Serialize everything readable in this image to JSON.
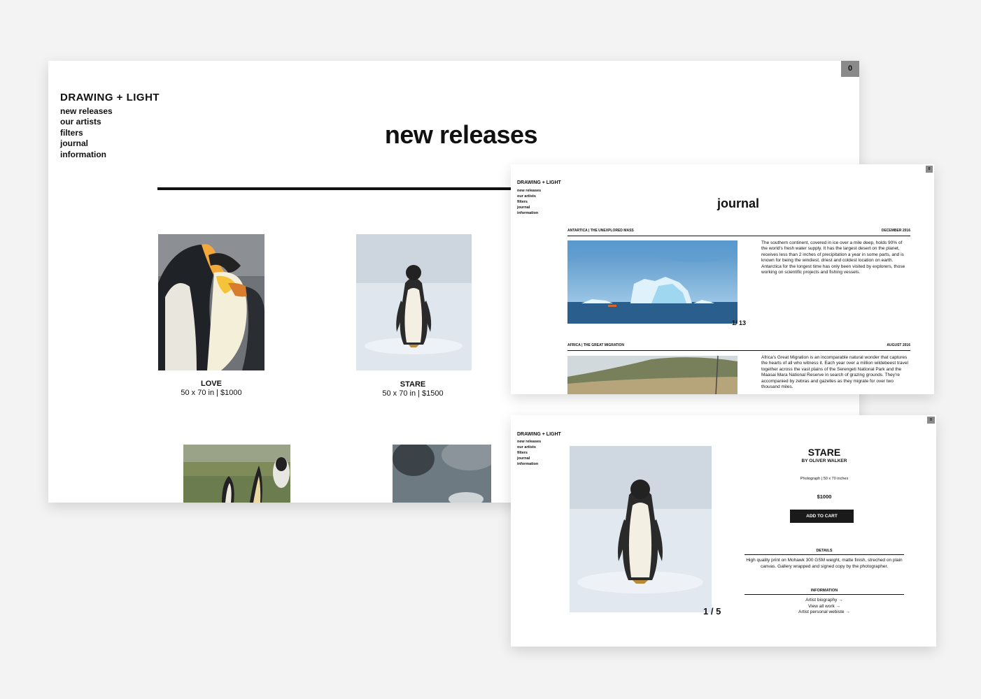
{
  "brand": "DRAWING + LIGHT",
  "nav": [
    "new releases",
    "our artists",
    "filters",
    "journal",
    "information"
  ],
  "cart_count": "0",
  "new_releases": {
    "title": "new releases",
    "items": [
      {
        "title": "LOVE",
        "meta": "50 x 70 in | $1000"
      },
      {
        "title": "STARE",
        "meta": "50 x 70 in | $1500"
      }
    ]
  },
  "journal": {
    "title": "journal",
    "entries": [
      {
        "heading": "ANTARTICA | THE UNEXPLORED MASS",
        "date": "DECEMBER 2016",
        "text": "The southern continent, covered in ice over a mile deep, holds 90% of the world's fresh water supply. It has the largest desert on the planet, receives less than 2 inches of precipitation a year in some parts, and is known for being the windiest, driest and coldest location on earth. Antarctica for the longest time has only been visited by explorers, those working on scientific projects and fishing vessels.",
        "counter": "1/ 13"
      },
      {
        "heading": "AFRICA | THE GREAT MIGRATION",
        "date": "AUGUST 2016",
        "text": "Africa's Great Migration is an incomparable natural wonder that captures the hearts of all who witness it. Each year over a million wildebeest travel together across the vast plains of the Serengeti National Park and the Maasai Mara National Reserve in search of grazing grounds. They're accompanied by zebras and gazelles as they migrate for over two thousand miles."
      }
    ]
  },
  "product": {
    "title": "STARE",
    "by": "BY OLIVER WALKER",
    "meta": "Photograph  |  50 x 70 inches",
    "price": "$1000",
    "add_to_cart": "ADD TO CART",
    "details_label": "DETAILS",
    "details_text": "High quality print on Mohawk 300 GSM weight, matte finish, streched on plain canvas. Gallery wrapped and signed copy by the photographer.",
    "information_label": "INFORMATION",
    "links": [
      "Artist biography →",
      "View all work →",
      "Artist personal webiste →"
    ],
    "counter": "1 / 5"
  }
}
